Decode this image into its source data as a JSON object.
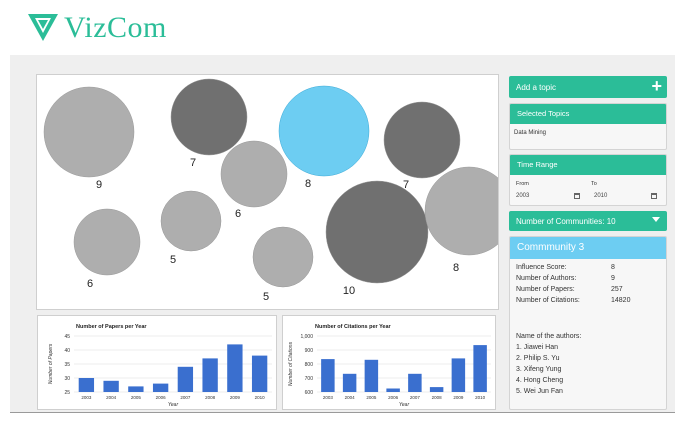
{
  "app": {
    "logo_text": "VizCom",
    "brand_color": "#2bbd98",
    "accent_color": "#6dcdf2"
  },
  "bubbles": [
    {
      "label": "9",
      "color": "#aeaeae",
      "highlighted": false
    },
    {
      "label": "7",
      "color": "#707070",
      "highlighted": false
    },
    {
      "label": "6",
      "color": "#aeaeae",
      "highlighted": false
    },
    {
      "label": "8",
      "color": "#6dcdf2",
      "highlighted": true
    },
    {
      "label": "7",
      "color": "#707070",
      "highlighted": false
    },
    {
      "label": "6",
      "color": "#aeaeae",
      "highlighted": false
    },
    {
      "label": "5",
      "color": "#aeaeae",
      "highlighted": false
    },
    {
      "label": "5",
      "color": "#aeaeae",
      "highlighted": false
    },
    {
      "label": "10",
      "color": "#707070",
      "highlighted": false
    },
    {
      "label": "8",
      "color": "#aeaeae",
      "highlighted": false
    }
  ],
  "chart_data": [
    {
      "type": "bar",
      "title": "Number of Papers per Year",
      "xlabel": "Year",
      "ylabel": "Number of Papers",
      "categories": [
        "2003",
        "2004",
        "2005",
        "2006",
        "2007",
        "2008",
        "2009",
        "2010"
      ],
      "values": [
        30,
        29,
        27,
        28,
        34,
        37,
        42,
        38
      ],
      "ylim": [
        25,
        45
      ],
      "yticks": [
        "25",
        "30",
        "35",
        "40",
        "45"
      ],
      "grid": true,
      "bar_color": "#3a6fcf"
    },
    {
      "type": "bar",
      "title": "Number of Citations per Year",
      "xlabel": "Year",
      "ylabel": "Number of Citations",
      "categories": [
        "2003",
        "2004",
        "2005",
        "2006",
        "2007",
        "2008",
        "2009",
        "2010"
      ],
      "values": [
        835,
        730,
        830,
        625,
        730,
        635,
        840,
        935
      ],
      "ylim": [
        600,
        1000
      ],
      "yticks": [
        "600",
        "700",
        "800",
        "900",
        "1,000"
      ],
      "grid": true,
      "bar_color": "#3a6fcf"
    }
  ],
  "sidebar": {
    "add_topic_label": "Add a topic",
    "add_topic_icon": "plus-icon",
    "selected_topics_title": "Selected Topics",
    "selected_topic": "Data Mining",
    "time_range_title": "Time Range",
    "from_label": "From",
    "from_value": "2003",
    "to_label": "To",
    "to_value": "2010",
    "communities_label": "Number of Communities: 10",
    "community": {
      "title": "Commmunity 3",
      "stats": [
        {
          "key": "Influence Score:",
          "value": "8"
        },
        {
          "key": "Number of Authors:",
          "value": "9"
        },
        {
          "key": "Number of Papers:",
          "value": "257"
        },
        {
          "key": "Number of Citations:",
          "value": "14820"
        }
      ],
      "authors_title": "Name of the authors:",
      "authors": [
        "1. Jiawei Han",
        "2. Philip S. Yu",
        "3. Xifeng Yung",
        "4. Hong Cheng",
        "5. Wei Jun Fan"
      ]
    }
  }
}
